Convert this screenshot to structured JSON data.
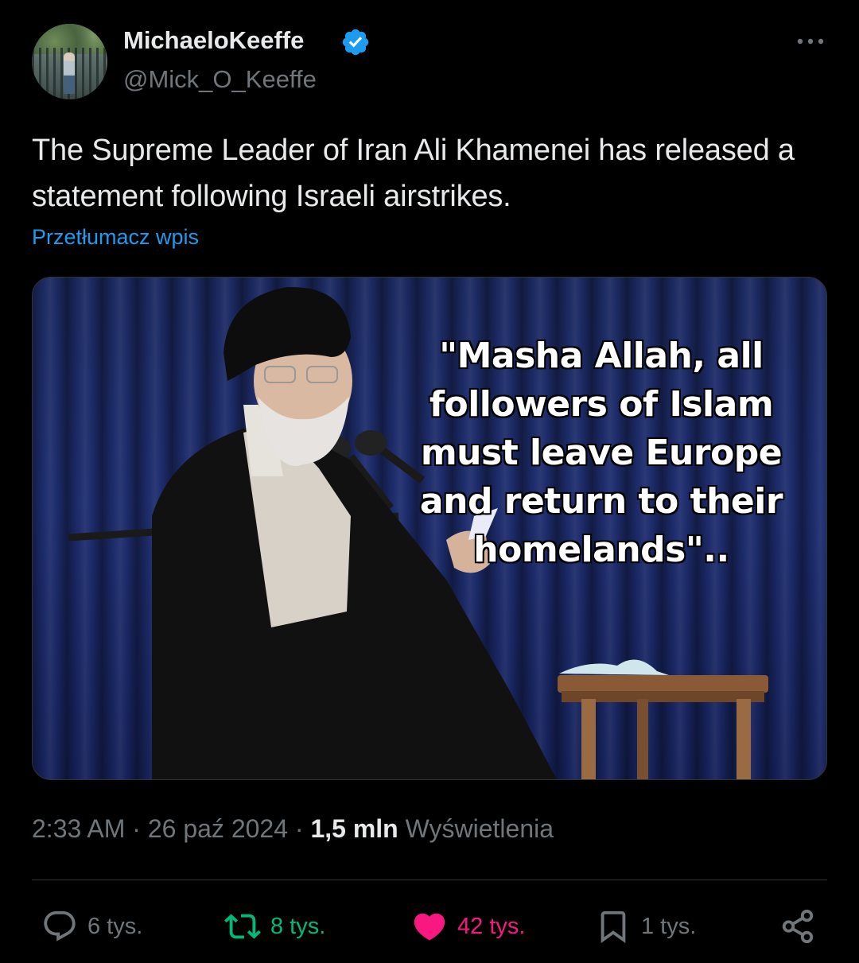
{
  "author": {
    "display_name": "MichaeloKeeffe",
    "handle": "@Mick_O_Keeffe",
    "verified": true
  },
  "tweet": {
    "text": "The Supreme Leader of Iran Ali Khamenei has released a statement following Israeli airstrikes.",
    "translate_label": "Przetłumacz wpis",
    "image_quote": "\"Masha Allah, all followers of Islam must leave Europe and return to their homelands\".."
  },
  "meta": {
    "time": "2:33 AM",
    "separator": " · ",
    "date": "26 paź 2024",
    "views_count": "1,5 mln",
    "views_label": "Wyświetlenia"
  },
  "actions": {
    "reply": {
      "icon": "reply-icon",
      "count": "6 tys."
    },
    "retweet": {
      "icon": "retweet-icon",
      "count": "8 tys."
    },
    "like": {
      "icon": "heart-icon",
      "count": "42 tys."
    },
    "bookmark": {
      "icon": "bookmark-icon",
      "count": "1 tys."
    },
    "share": {
      "icon": "share-icon"
    }
  },
  "colors": {
    "background": "#000000",
    "text": "#e7e9ea",
    "secondary": "#71767b",
    "link": "#1d9bf0",
    "retweet": "#00ba7c",
    "like": "#f91880"
  }
}
